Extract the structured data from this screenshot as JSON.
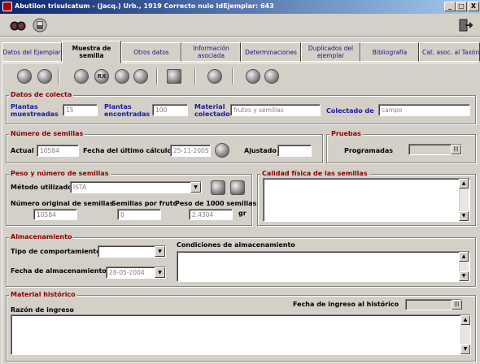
{
  "window": {
    "title": "Abutilon trisulcatum - (Jacq.) Urb., 1919  Correcto  nulo  IdEjemplar: 643",
    "minimize": "_",
    "maximize": "□",
    "close": "X"
  },
  "toolbar": {
    "icons": [
      "binoculars-icon",
      "save-icon",
      "exit-icon"
    ]
  },
  "tabs": [
    {
      "label": "Datos del Ejemplar"
    },
    {
      "label": "Muestra de semilla"
    },
    {
      "label": "Otros datos"
    },
    {
      "label": "Información asociada"
    },
    {
      "label": "Determinaciones"
    },
    {
      "label": "Duplicados del ejemplar"
    },
    {
      "label": "Bibliografía"
    },
    {
      "label": "Cat. asoc. al Taxón"
    }
  ],
  "subtoolbar": {
    "rx_label": "RX"
  },
  "colecta": {
    "legend": "Datos de colecta",
    "plantas_muestreadas_label": "Plantas muestreadas",
    "plantas_muestreadas": "15",
    "plantas_encontradas_label": "Plantas encontradas",
    "plantas_encontradas": "100",
    "material_label": "Material colectado",
    "material": "frutos y semillas",
    "colectado_label": "Colectado de",
    "colectado": "campo"
  },
  "semillas": {
    "legend": "Número de semillas",
    "actual_label": "Actual",
    "actual": "10584",
    "fecha_calculo_label": "Fecha del último cálculo",
    "fecha_calculo": "25-11-2005",
    "ajustado_label": "Ajustado",
    "ajustado": ""
  },
  "pruebas": {
    "legend": "Pruebas",
    "programadas_label": "Programadas",
    "programadas": ""
  },
  "peso": {
    "legend": "Peso y número de semillas",
    "metodo_label": "Método utilizado",
    "metodo": "ISTA",
    "numero_original_label": "Número original de semillas",
    "numero_original": "10584",
    "semillas_fruto_label": "Semillas por fruto",
    "semillas_fruto": "0",
    "peso_1000_label": "Peso de 1000 semillas",
    "peso_1000": "2.4304",
    "unidad": "gr"
  },
  "calidad": {
    "legend": "Calidad física de las semillas",
    "texto": ""
  },
  "almacenamiento": {
    "legend": "Almacenamiento",
    "tipo_label": "Tipo de comportamiento",
    "tipo": "",
    "fecha_label": "Fecha de almacenamiento",
    "fecha": "28-05-2004",
    "condiciones_label": "Condiciones de almacenamiento",
    "condiciones": ""
  },
  "historico": {
    "legend": "Material histórico",
    "razon_label": "Razón de ingreso",
    "razon": "",
    "fecha_ingreso_label": "Fecha de ingreso al histórico",
    "fecha_ingreso": ""
  },
  "glyphs": {
    "up": "▲",
    "down": "▼",
    "dots": "|||"
  }
}
